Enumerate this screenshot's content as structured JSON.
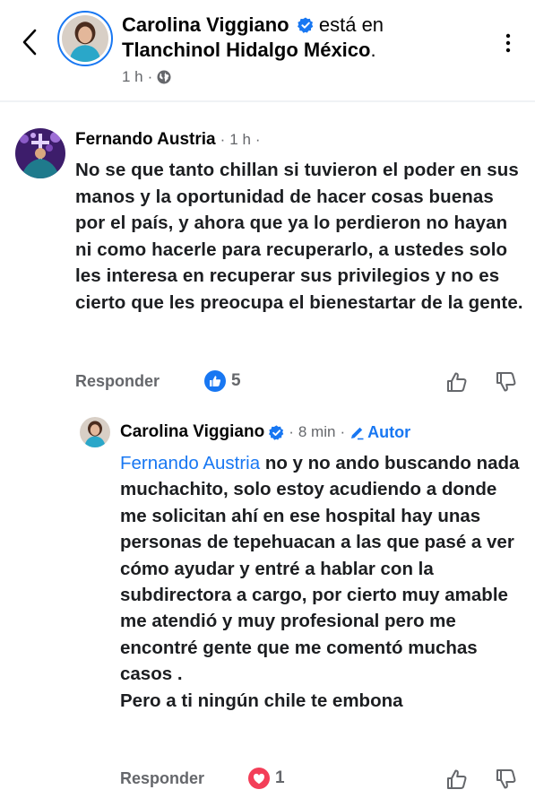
{
  "post": {
    "author": "Carolina Viggiano",
    "checkin_text": "está en",
    "location": "Tlanchinol Hidalgo México",
    "time": "1 h",
    "separator": "·"
  },
  "comment": {
    "author": "Fernando Austria",
    "time": "1 h",
    "text": "No se que tanto chillan si tuvieron el poder en sus manos y la oportunidad de hacer cosas buenas por el país, y ahora que ya lo perdieron no hayan ni como hacerle para recuperarlo, a ustedes solo les interesa en recuperar sus privilegios y no es cierto que les preocupa el bienestartar de la gente.",
    "reply_label": "Responder",
    "reaction_count": "5"
  },
  "reply": {
    "author": "Carolina Viggiano",
    "time": "8 min",
    "author_badge": "Autor",
    "mention": "Fernando Austria",
    "text": " no y no ando buscando nada muchachito, solo estoy acudiendo a donde me solicitan ahí en ese hospital hay unas personas de tepehuacan a las que pasé a ver cómo ayudar y entré a hablar con la subdirectora a cargo, por cierto muy amable me atendió y muy profesional pero me encontré gente que me comentó muchas casos .",
    "text_line2": "Pero a ti ningún chile te embona",
    "reply_label": "Responder",
    "reaction_count": "1"
  },
  "colors": {
    "accent": "#1877f2",
    "love": "#f33e58",
    "muted": "#65676b"
  }
}
